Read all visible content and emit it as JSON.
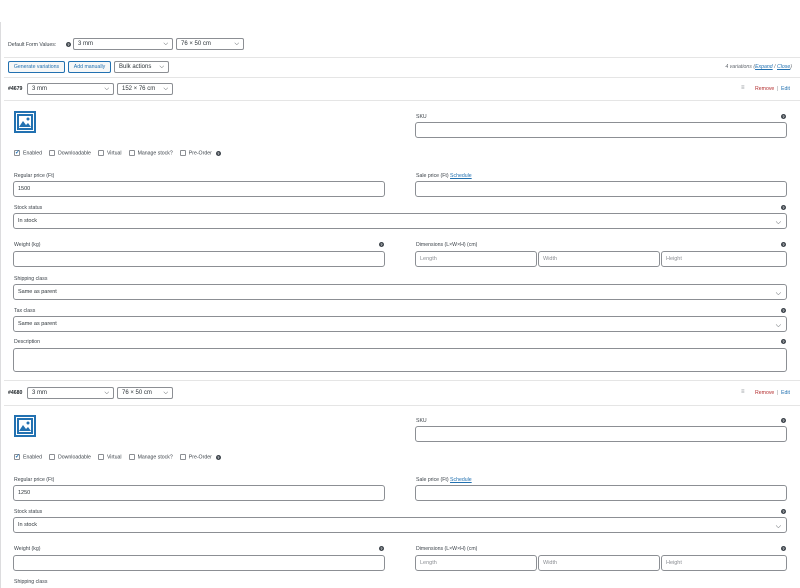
{
  "defaults": {
    "label": "Default Form Values:",
    "thickness": "3 mm",
    "size": "76 × 50 cm"
  },
  "toolbar": {
    "generate": "Generate variations",
    "add": "Add manually",
    "bulk": "Bulk actions",
    "summary": "4 variations (",
    "expand": "Expand",
    "slash": " / ",
    "close": "Close",
    "end": ")"
  },
  "variations": [
    {
      "id": "#4679",
      "thickness": "3 mm",
      "size": "152 × 76 cm",
      "remove": "Remove",
      "edit": "Edit",
      "sku_label": "SKU",
      "checkboxes": [
        {
          "label": "Enabled",
          "checked": true
        },
        {
          "label": "Downloadable",
          "checked": false
        },
        {
          "label": "Virtual",
          "checked": false
        },
        {
          "label": "Manage stock?",
          "checked": false
        },
        {
          "label": "Pre-Order",
          "checked": false
        }
      ],
      "regular_label": "Regular price (Ft)",
      "regular_value": "1500",
      "sale_label": "Sale price (Ft)",
      "schedule": "Schedule",
      "stock_label": "Stock status",
      "stock_value": "In stock",
      "weight_label": "Weight (kg)",
      "dims_label": "Dimensions (L×W×H) (cm)",
      "length": "Length",
      "width": "Width",
      "height": "Height",
      "shipping_label": "Shipping class",
      "shipping_value": "Same as parent",
      "tax_label": "Tax class",
      "tax_value": "Same as parent",
      "desc_label": "Description"
    },
    {
      "id": "#4680",
      "thickness": "3 mm",
      "size": "76 × 50 cm",
      "remove": "Remove",
      "edit": "Edit",
      "sku_label": "SKU",
      "checkboxes": [
        {
          "label": "Enabled",
          "checked": true
        },
        {
          "label": "Downloadable",
          "checked": false
        },
        {
          "label": "Virtual",
          "checked": false
        },
        {
          "label": "Manage stock?",
          "checked": false
        },
        {
          "label": "Pre-Order",
          "checked": false
        }
      ],
      "regular_label": "Regular price (Ft)",
      "regular_value": "1250",
      "sale_label": "Sale price (Ft)",
      "schedule": "Schedule",
      "stock_label": "Stock status",
      "stock_value": "In stock",
      "weight_label": "Weight (kg)",
      "dims_label": "Dimensions (L×W×H) (cm)",
      "length": "Length",
      "width": "Width",
      "height": "Height",
      "shipping_label": "Shipping class"
    }
  ],
  "colors": {
    "accent": "#2271b1",
    "remove": "#b32d2e",
    "border": "#8c8f94"
  }
}
